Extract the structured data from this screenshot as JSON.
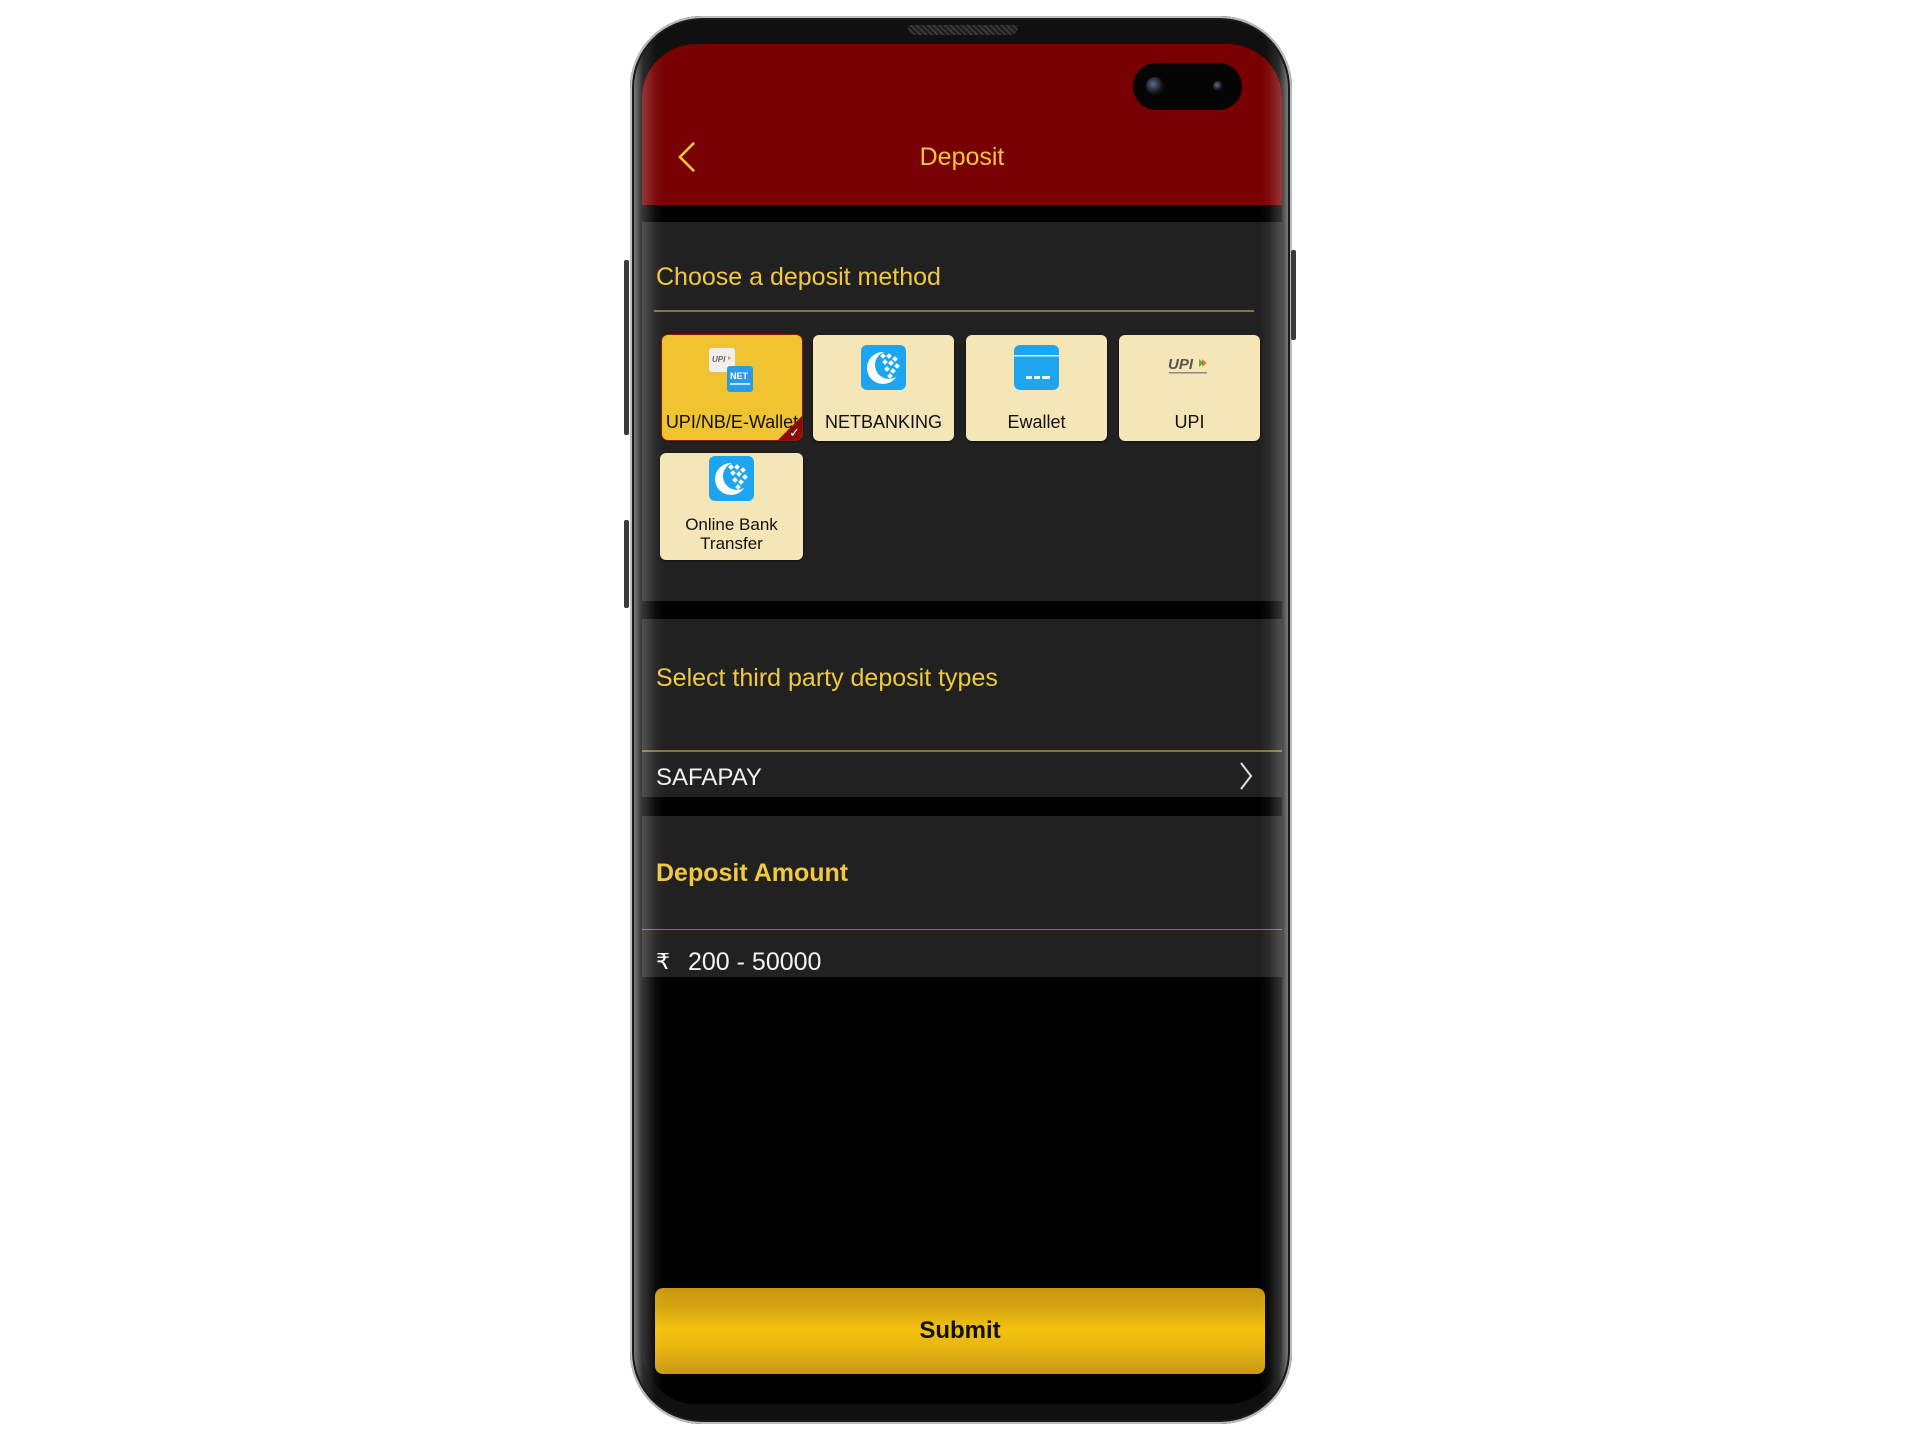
{
  "header": {
    "title": "Deposit",
    "back_icon": "chevron-left-icon"
  },
  "deposit_method": {
    "title": "Choose a deposit method",
    "options": [
      {
        "label": "UPI/NB/E-Wallet",
        "icon": "upi-netbanking-combo-icon",
        "selected": true
      },
      {
        "label": "NETBANKING",
        "icon": "webmoney-globe-icon",
        "selected": false
      },
      {
        "label": "Ewallet",
        "icon": "card-wallet-icon",
        "selected": false
      },
      {
        "label": "UPI",
        "icon": "upi-logo-icon",
        "selected": false
      },
      {
        "label": "Online Bank Transfer",
        "icon": "webmoney-globe-icon",
        "selected": false
      }
    ],
    "selected_check_icon": "checkmark-icon"
  },
  "third_party": {
    "title": "Select third party deposit types",
    "selected_value": "SAFAPAY",
    "chevron_icon": "chevron-right-icon"
  },
  "deposit_amount": {
    "title": "Deposit Amount",
    "currency_symbol": "₹",
    "value": "",
    "placeholder": "200 - 50000"
  },
  "submit_label": "Submit",
  "colors": {
    "header_bg": "#780000",
    "accent_gold": "#f1c840",
    "section_bg": "#212121",
    "tile_bg": "#f5e6b8",
    "tile_selected_bg": "#f0c431",
    "button_gold": "#f3c20d"
  }
}
